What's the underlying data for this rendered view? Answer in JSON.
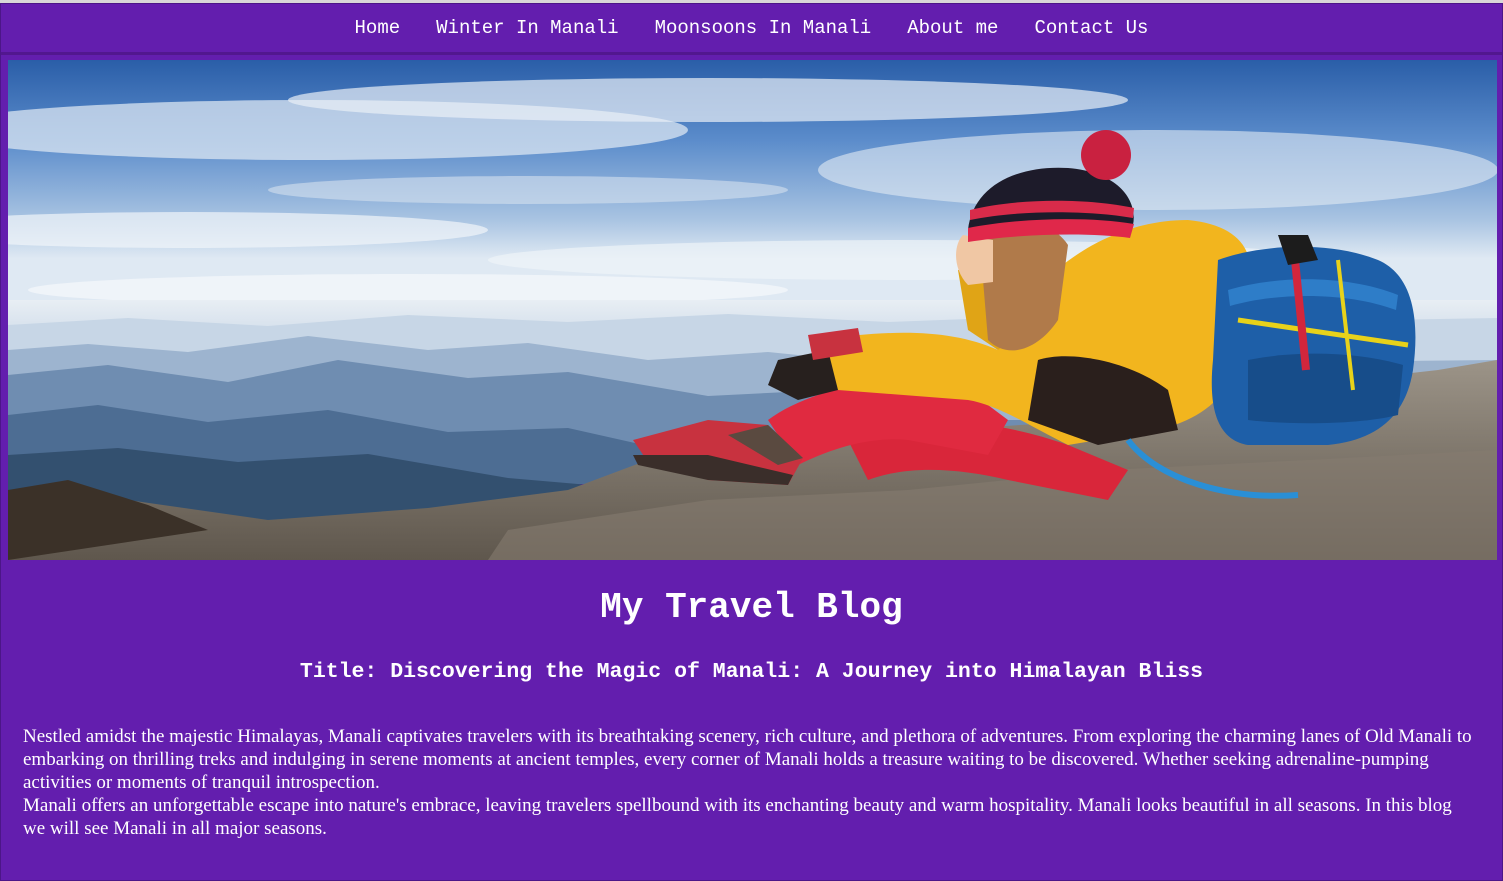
{
  "nav": {
    "items": [
      {
        "label": "Home"
      },
      {
        "label": "Winter In Manali"
      },
      {
        "label": "Moonsoons In Manali"
      },
      {
        "label": "About me"
      },
      {
        "label": "Contact Us"
      }
    ]
  },
  "hero": {
    "description": "Hiker with yellow jacket, red beanie and blue backpack sitting on a rocky peak overlooking misty Himalayan mountain ranges under a blue sky"
  },
  "main": {
    "heading": "My Travel Blog",
    "post_title": "Title: Discovering the Magic of Manali: A Journey into Himalayan Bliss",
    "paragraphs": [
      "Nestled amidst the majestic Himalayas, Manali captivates travelers with its breathtaking scenery, rich culture, and plethora of adventures. From exploring the charming lanes of Old Manali to embarking on thrilling treks and indulging in serene moments at ancient temples, every corner of Manali holds a treasure waiting to be discovered. Whether seeking adrenaline-pumping activities or moments of tranquil introspection.",
      "Manali offers an unforgettable escape into nature's embrace, leaving travelers spellbound with its enchanting beauty and warm hospitality. Manali looks beautiful in all seasons. In this blog we will see Manali in all major seasons."
    ]
  },
  "colors": {
    "page_background": "#631eae",
    "text": "#ffffff"
  }
}
